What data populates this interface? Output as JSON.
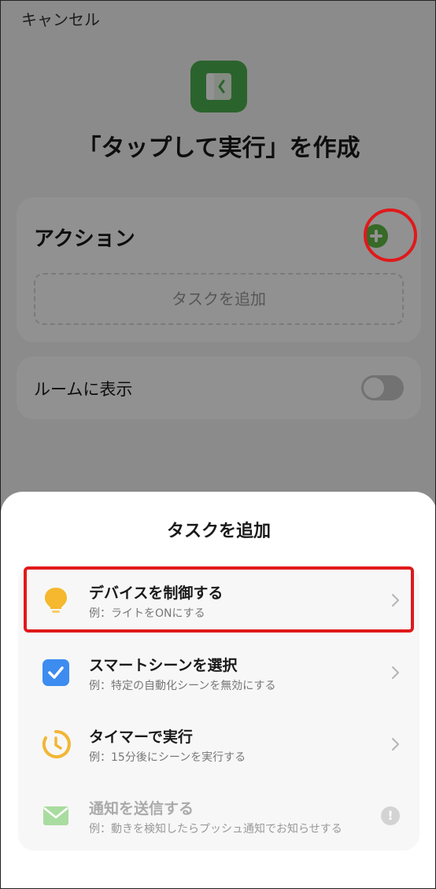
{
  "header": {
    "cancel_label": "キャンセル",
    "title": "「タップして実行」を作成"
  },
  "action_card": {
    "title": "アクション",
    "add_task_label": "タスクを追加"
  },
  "room_card": {
    "label": "ルームに表示",
    "toggle_on": false
  },
  "sheet": {
    "title": "タスクを追加",
    "options": [
      {
        "title": "デバイスを制御する",
        "subtitle": "例：ライトをONにする",
        "icon": "lightbulb-icon",
        "enabled": true
      },
      {
        "title": "スマートシーンを選択",
        "subtitle": "例：特定の自動化シーンを無効にする",
        "icon": "checkbox-icon",
        "enabled": true
      },
      {
        "title": "タイマーで実行",
        "subtitle": "例：15分後にシーンを実行する",
        "icon": "timer-icon",
        "enabled": true
      },
      {
        "title": "通知を送信する",
        "subtitle": "例：動きを検知したらプッシュ通知でお知らせする",
        "icon": "envelope-icon",
        "enabled": false
      }
    ]
  },
  "colors": {
    "accent_green": "#62b946",
    "highlight_red": "#e0191b",
    "bulb_yellow": "#f5b82e",
    "scene_blue": "#3d8cf0",
    "timer_yellow": "#f2b635",
    "mail_green": "#a9dca0"
  }
}
